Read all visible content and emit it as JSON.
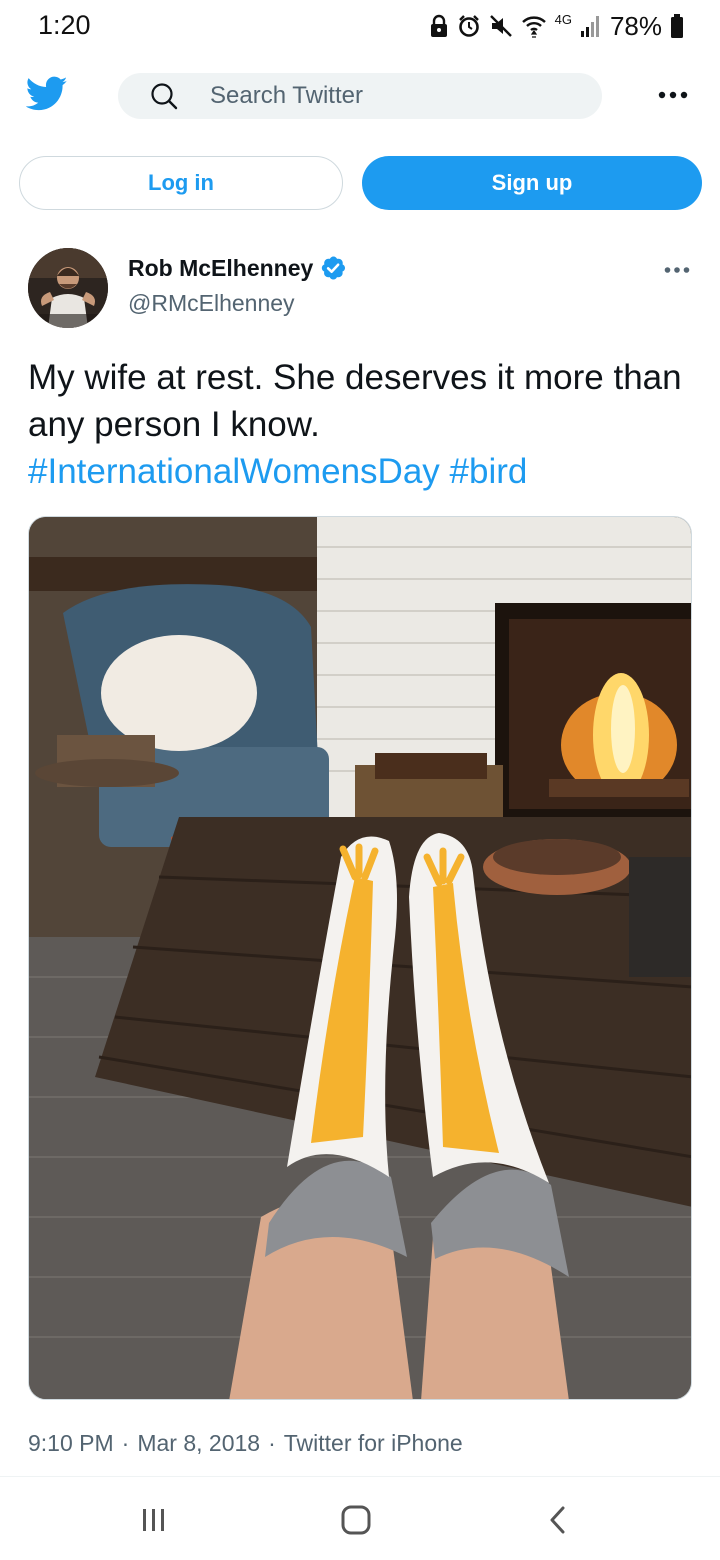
{
  "status_bar": {
    "time": "1:20",
    "network": "4G",
    "battery": "78%"
  },
  "header": {
    "logo_icon": "twitter-bird-icon",
    "search_placeholder": "Search Twitter",
    "more_icon": "more-horizontal-icon"
  },
  "auth": {
    "login_label": "Log in",
    "signup_label": "Sign up"
  },
  "tweet": {
    "author_name": "Rob McElhenney",
    "author_handle": "@RMcElhenney",
    "verified": true,
    "text": "My wife at rest. She deserves it more than any person I know.",
    "hashtags": [
      "#InternationalWomensDay",
      "#bird"
    ],
    "media_description_icon": "photo-icon",
    "time": "9:10 PM",
    "date": "Mar 8, 2018",
    "source": "Twitter for iPhone"
  },
  "colors": {
    "brand": "#1d9bf0",
    "text_primary": "#0f1419",
    "text_secondary": "#536471",
    "search_bg": "#eff3f4"
  },
  "nav_bar": {
    "recents_icon": "recents-icon",
    "home_icon": "home-icon",
    "back_icon": "back-icon"
  }
}
